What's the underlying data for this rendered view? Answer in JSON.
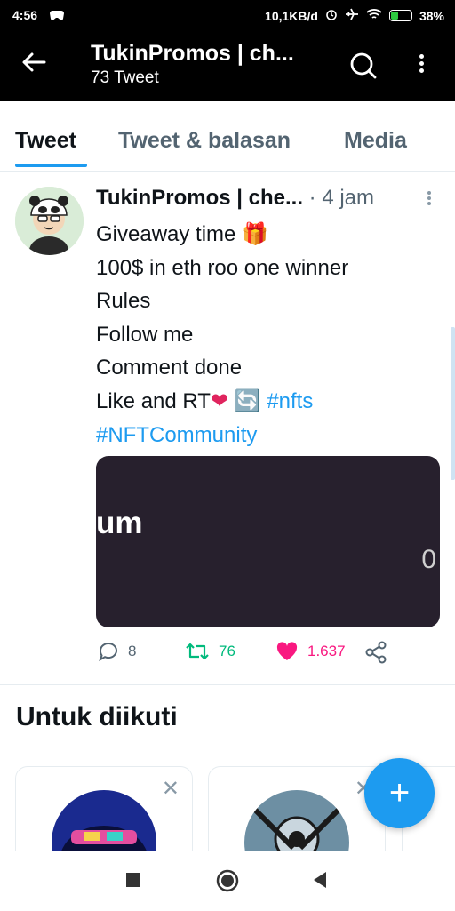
{
  "status_bar": {
    "time": "4:56",
    "left_icon": "game-controller-icon",
    "network_speed": "10,1KB/d",
    "icons": [
      "alarm-icon",
      "airplane-mode-icon",
      "wifi-icon"
    ],
    "battery_percent": "38%",
    "battery_level": 0.38,
    "battery_color": "#2ecc40"
  },
  "app_bar": {
    "back_icon": "arrow-left-icon",
    "title": "TukinPromos | ch...",
    "subtitle": "73 Tweet",
    "search_icon": "search-icon",
    "more_icon": "more-vertical-icon"
  },
  "tabs": [
    {
      "label": "Tweet",
      "active": true
    },
    {
      "label": "Tweet & balasan",
      "active": false
    },
    {
      "label": "Media",
      "active": false
    }
  ],
  "tweet": {
    "name": "TukinPromos | che...",
    "separator": "·",
    "time": "4 jam",
    "lines": {
      "giveaway": "Giveaway time",
      "gift_emoji": "🎁",
      "prize": "100$ in eth roo one winner",
      "rules": "Rules",
      "follow": "Follow me",
      "comment": "Comment done",
      "like_rt": "Like and RT",
      "heart_emoji": "❤",
      "repeat_emoji": "🔄",
      "hashtag1": "#nfts",
      "hashtag2": "#NFTCommunity"
    },
    "media": {
      "text1": "um",
      "text2": "0"
    },
    "actions": {
      "replies": "8",
      "retweets": "76",
      "likes": "1.637"
    }
  },
  "suggestions": {
    "title": "Untuk diikuti",
    "dismiss": "✕"
  },
  "fab": {
    "label": "+"
  },
  "colors": {
    "accent": "#1d9bf0",
    "retweet": "#00ba7c",
    "like": "#f91880",
    "secondary_text": "#536471"
  }
}
